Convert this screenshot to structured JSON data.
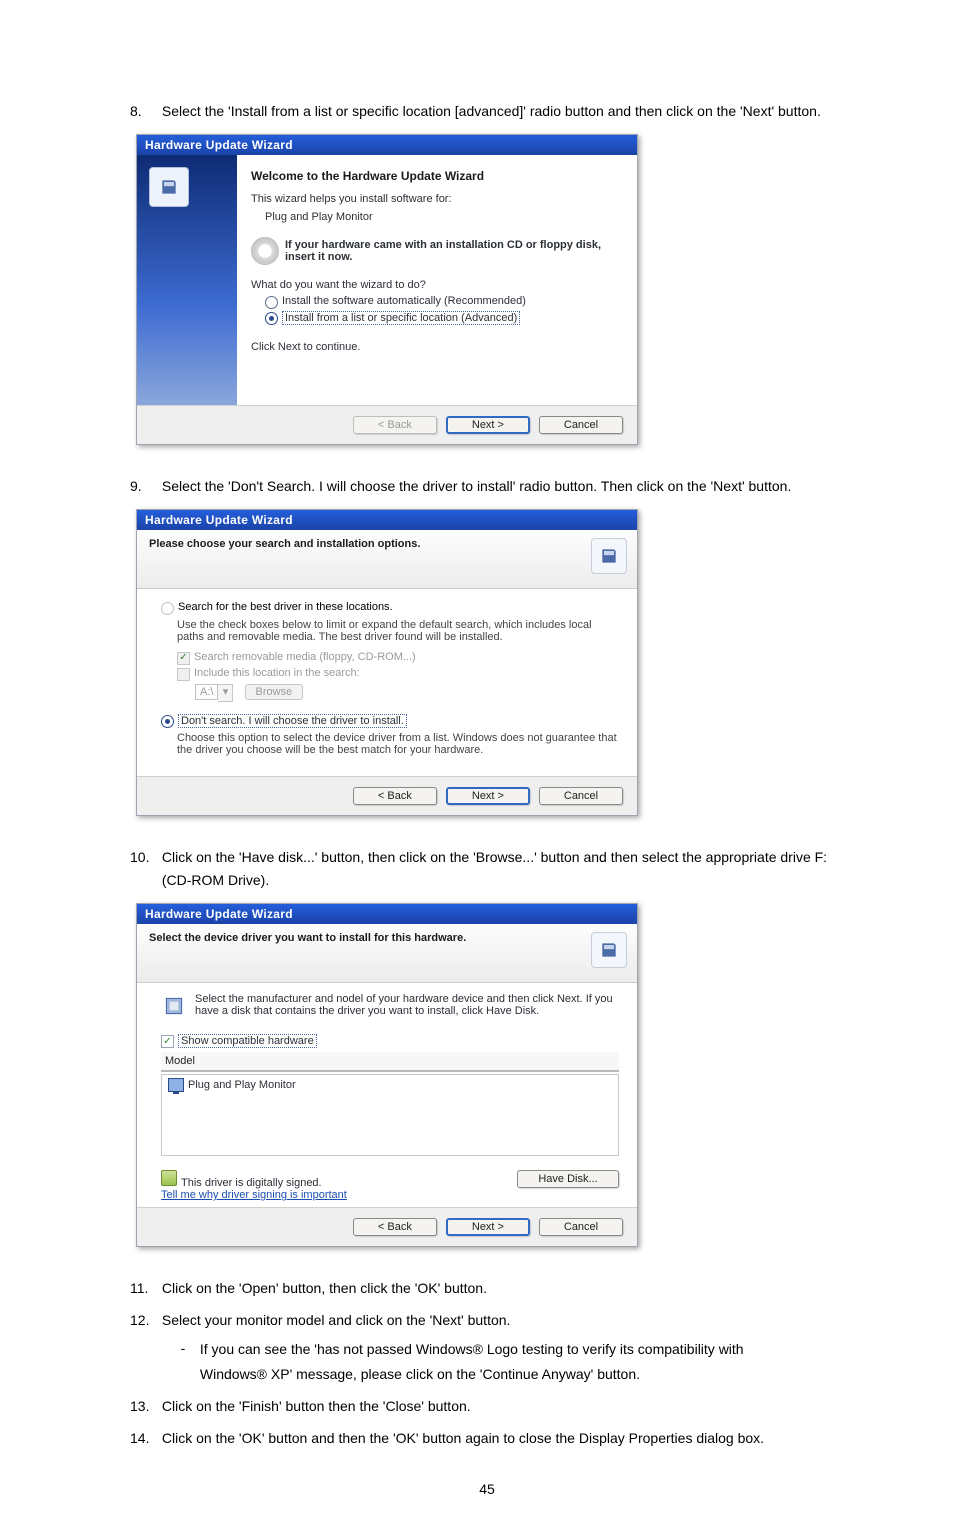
{
  "steps": {
    "s8": {
      "num": "8.",
      "text": "Select the 'Install from a list or specific location [advanced]' radio button and then click on the 'Next' button."
    },
    "s9": {
      "num": "9.",
      "text": "Select the 'Don't Search. I will choose the driver to install' radio button. Then click on the 'Next' button."
    },
    "s10": {
      "num": "10.",
      "text": "Click on the 'Have disk...' button, then click on the 'Browse...' button and then select the appropriate drive F: (CD-ROM Drive)."
    },
    "s11": {
      "num": "11.",
      "text": "Click on the 'Open' button, then click the 'OK' button."
    },
    "s12": {
      "num": "12.",
      "text": "Select your monitor model and click on the 'Next' button.",
      "sub_dash": "-",
      "sub": "If you can see the 'has not passed Windows® Logo testing to verify its compatibility with Windows® XP' message, please click on the 'Continue Anyway' button."
    },
    "s13": {
      "num": "13.",
      "text": "Click on the 'Finish' button then the 'Close' button."
    },
    "s14": {
      "num": "14.",
      "text": "Click on the 'OK' button and then the 'OK' button again to close the Display Properties dialog box."
    }
  },
  "dlg1": {
    "title": "Hardware Update Wizard",
    "h1": "Welcome to the Hardware Update Wizard",
    "line_helps": "This wizard helps you install software for:",
    "device": "Plug and Play Monitor",
    "cd_line": "If your hardware came with an installation CD or floppy disk, insert it now.",
    "q": "What do you want the wizard to do?",
    "opt_auto": "Install the software automatically (Recommended)",
    "opt_list": "Install from a list or specific location (Advanced)",
    "click_next": "Click Next to continue.",
    "back": "< Back",
    "next": "Next >",
    "cancel": "Cancel"
  },
  "dlg2": {
    "title": "Hardware Update Wizard",
    "top": "Please choose your search and installation options.",
    "r1": "Search for the best driver in these locations.",
    "r1_note": "Use the check boxes below to limit or expand the default search, which includes local paths and removable media. The best driver found will be installed.",
    "c1": "Search removable media (floppy, CD-ROM...)",
    "c2": "Include this location in the search:",
    "path": "A:\\",
    "browse": "Browse",
    "r2": "Don't search. I will choose the driver to install.",
    "r2_note": "Choose this option to select the device driver from a list. Windows does not guarantee that the driver you choose will be the best match for your hardware.",
    "back": "< Back",
    "next": "Next >",
    "cancel": "Cancel"
  },
  "dlg3": {
    "title": "Hardware Update Wizard",
    "top": "Select the device driver you want to install for this hardware.",
    "note": "Select the manufacturer and nodel of your hardware device and then click Next. If you have a disk that contains the driver you want to install, click Have Disk.",
    "compat": "Show compatible hardware",
    "col_model": "Model",
    "model": "Plug and Play Monitor",
    "signed": "This driver is digitally signed.",
    "why": "Tell me why driver signing is important",
    "have_disk": "Have Disk...",
    "back": "< Back",
    "next": "Next >",
    "cancel": "Cancel"
  },
  "page_number": "45"
}
